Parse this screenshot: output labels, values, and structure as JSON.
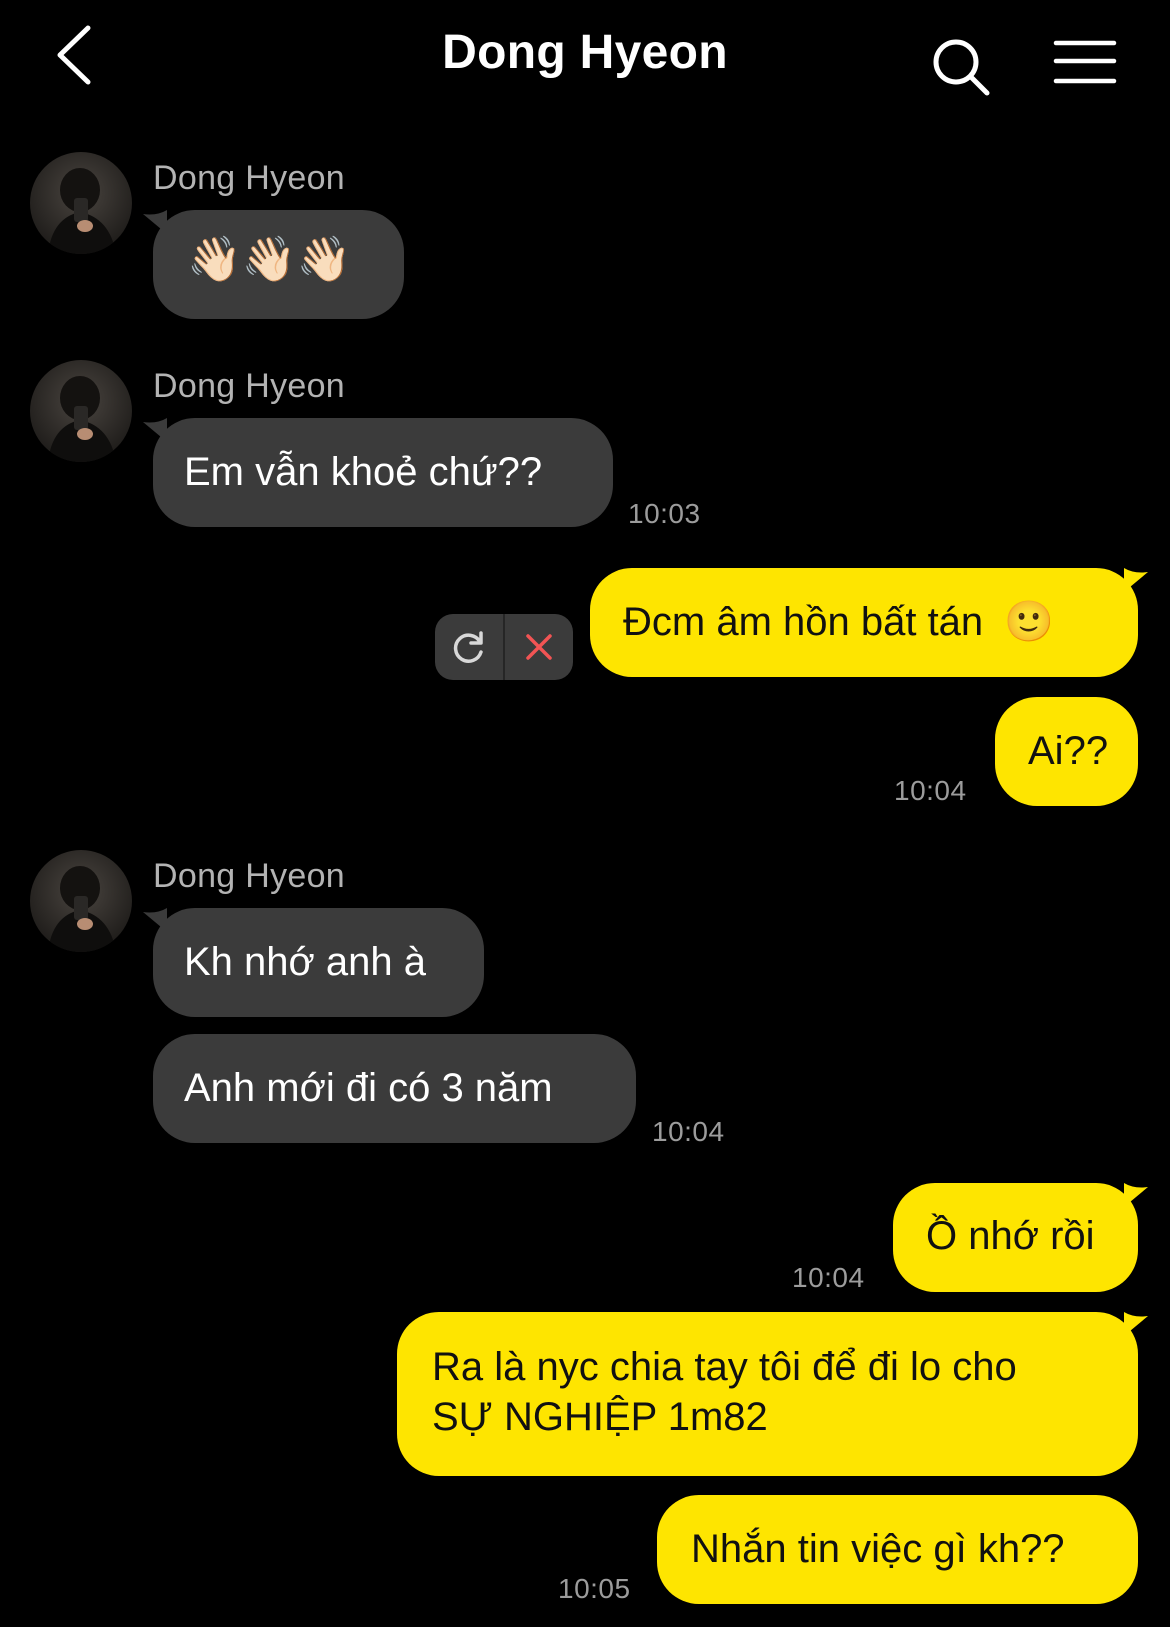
{
  "header": {
    "title": "Dong Hyeon",
    "back_icon": "chevron-left-icon",
    "search_icon": "search-icon",
    "menu_icon": "hamburger-menu-icon"
  },
  "colors": {
    "background": "#000000",
    "incoming_bubble": "#3b3b3b",
    "outgoing_bubble": "#fee500",
    "timestamp": "#9c9c9c",
    "delete_icon": "#f25454"
  },
  "messages": [
    {
      "group": 1,
      "sender": "Dong Hyeon",
      "direction": "in",
      "content": "👋🏻👋🏻👋🏻"
    },
    {
      "group": 2,
      "sender": "Dong Hyeon",
      "direction": "in",
      "content": "Em vẫn khoẻ chứ??",
      "time": "10:03"
    },
    {
      "group": 3,
      "direction": "out",
      "content": "Đcm âm hồn bất tán",
      "emoji": "🙂",
      "status": "failed"
    },
    {
      "group": 3,
      "direction": "out",
      "content": "Ai??",
      "time": "10:04"
    },
    {
      "group": 4,
      "sender": "Dong Hyeon",
      "direction": "in",
      "content": "Kh nhớ anh à"
    },
    {
      "group": 4,
      "direction": "in",
      "content": "Anh mới đi có 3 năm",
      "time": "10:04"
    },
    {
      "group": 5,
      "direction": "out",
      "content": "Ồ nhớ rồi",
      "time": "10:04"
    },
    {
      "group": 6,
      "direction": "out",
      "lines": [
        "Ra là nyc chia tay tôi để đi lo cho",
        "SỰ NGHIỆP 1m82"
      ]
    },
    {
      "group": 6,
      "direction": "out",
      "content": "Nhắn tin việc gì kh??",
      "time": "10:05"
    }
  ]
}
